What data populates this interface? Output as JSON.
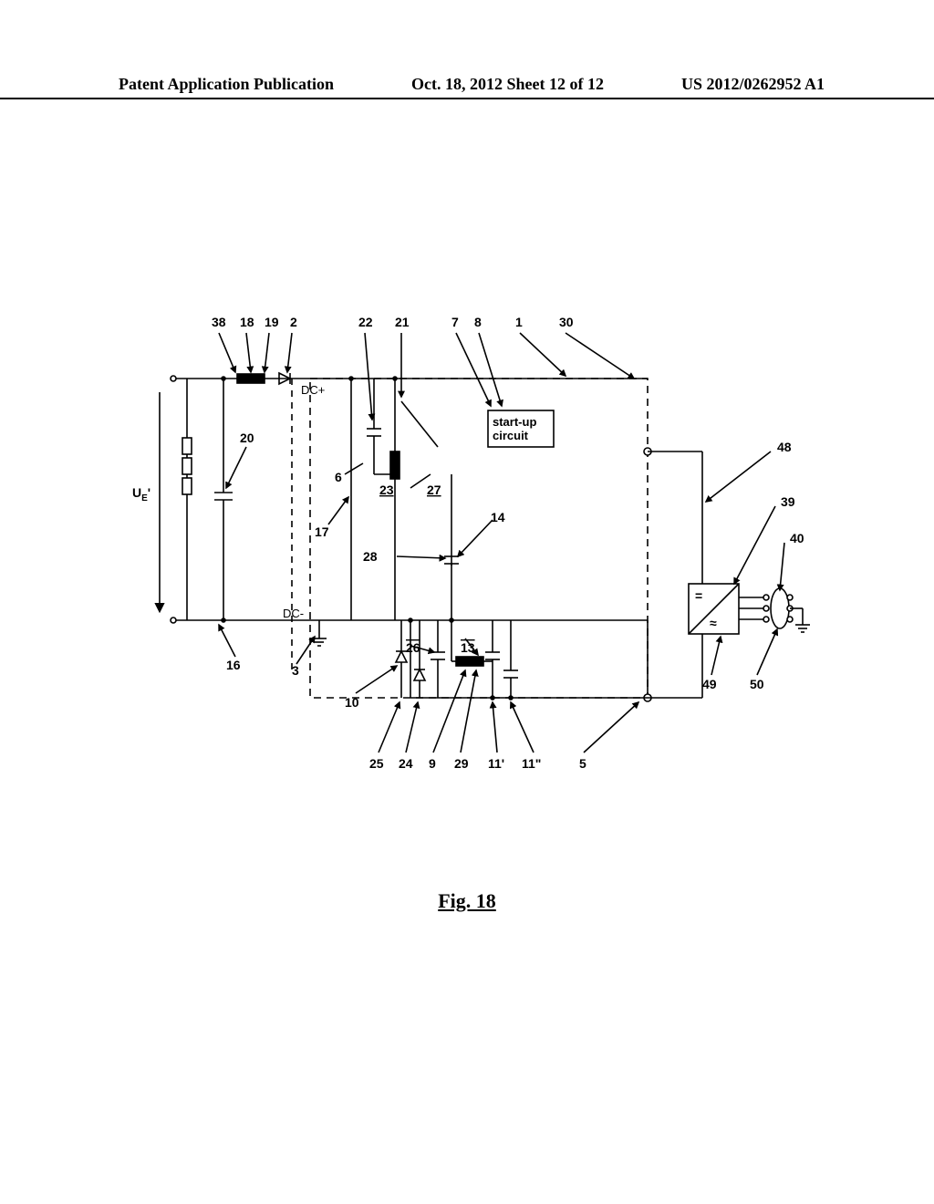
{
  "header": {
    "left": "Patent Application Publication",
    "center": "Oct. 18, 2012  Sheet 12 of 12",
    "right": "US 2012/0262952 A1"
  },
  "figure": {
    "caption": "Fig. 18",
    "input_voltage_label": "U",
    "input_voltage_sub": "E",
    "input_voltage_prime": "'",
    "dc_plus": "DC+",
    "dc_minus": "DC-",
    "startup_box": "start-up\ncircuit",
    "inv_top": "=",
    "inv_bottom": "≈",
    "labels_top": [
      "38",
      "18",
      "19",
      "2",
      "22",
      "21",
      "7",
      "8",
      "1",
      "30"
    ],
    "labels_bottom": [
      "25",
      "24",
      "9",
      "29",
      "11'",
      "11\"",
      "5"
    ],
    "labels_right": [
      "48",
      "39",
      "40",
      "49",
      "50"
    ],
    "labels_mid": {
      "n20": "20",
      "n6": "6",
      "n23": "23",
      "n27": "27",
      "n17": "17",
      "n28": "28",
      "n14": "14",
      "n16": "16",
      "n3": "3",
      "n10": "10",
      "n26": "26",
      "n13": "13"
    }
  }
}
